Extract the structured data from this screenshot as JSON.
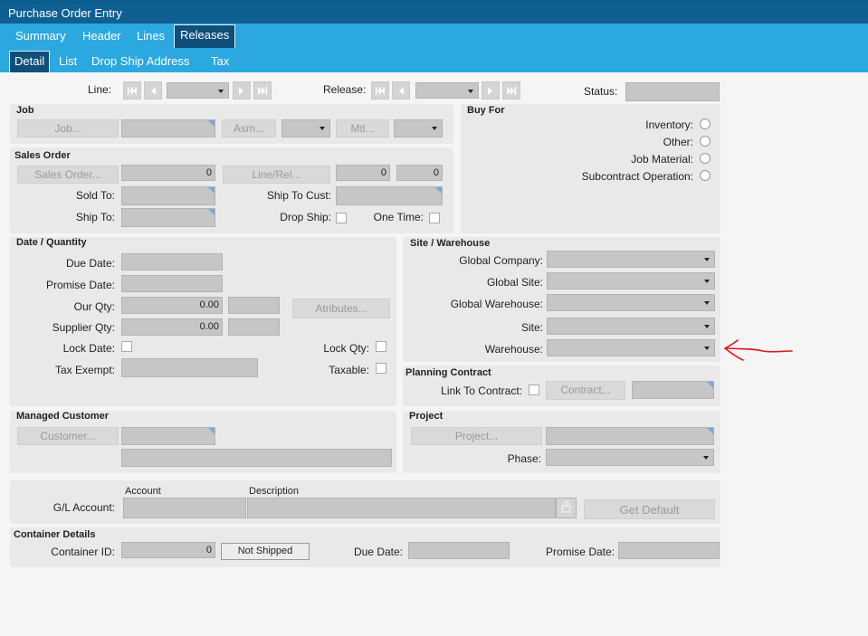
{
  "window": {
    "title": "Purchase Order Entry"
  },
  "tabs_main": [
    {
      "label": "Summary",
      "active": false
    },
    {
      "label": "Header",
      "active": false
    },
    {
      "label": "Lines",
      "active": false
    },
    {
      "label": "Releases",
      "active": true
    }
  ],
  "tabs_sub": [
    {
      "label": "Detail",
      "active": true
    },
    {
      "label": "List",
      "active": false
    },
    {
      "label": "Drop Ship Address",
      "active": false
    },
    {
      "label": "Tax",
      "active": false
    }
  ],
  "nav": {
    "line_label": "Line:",
    "release_label": "Release:",
    "status_label": "Status:"
  },
  "job": {
    "title": "Job",
    "job_button": "Job...",
    "asm_button": "Asm...",
    "mtl_button": "Mtl..."
  },
  "buy_for": {
    "title": "Buy For",
    "options": [
      "Inventory:",
      "Other:",
      "Job Material:",
      "Subcontract Operation:"
    ]
  },
  "sales_order": {
    "title": "Sales Order",
    "sales_order_button": "Sales Order...",
    "sales_order_value": "0",
    "line_rel_button": "Line/Rel...",
    "line_value": "0",
    "rel_value": "0",
    "sold_to_label": "Sold To:",
    "ship_to_cust_label": "Ship To Cust:",
    "ship_to_label": "Ship To:",
    "drop_ship_label": "Drop Ship:",
    "one_time_label": "One Time:"
  },
  "date_qty": {
    "title": "Date / Quantity",
    "due_date_label": "Due Date:",
    "promise_date_label": "Promise Date:",
    "our_qty_label": "Our Qty:",
    "our_qty_value": "0.00",
    "supplier_qty_label": "Supplier Qty:",
    "supplier_qty_value": "0.00",
    "attributes_button": "Atributes...",
    "lock_date_label": "Lock Date:",
    "lock_qty_label": "Lock Qty:",
    "tax_exempt_label": "Tax Exempt:",
    "taxable_label": "Taxable:"
  },
  "site_warehouse": {
    "title": "Site / Warehouse",
    "global_company_label": "Global Company:",
    "global_site_label": "Global Site:",
    "global_warehouse_label": "Global Warehouse:",
    "site_label": "Site:",
    "warehouse_label": "Warehouse:"
  },
  "planning_contract": {
    "title": "Planning Contract",
    "link_label": "Link To Contract:",
    "contract_button": "Contract..."
  },
  "managed_customer": {
    "title": "Managed Customer",
    "customer_button": "Customer..."
  },
  "project": {
    "title": "Project",
    "project_button": "Project...",
    "phase_label": "Phase:"
  },
  "gl": {
    "account_header": "Account",
    "description_header": "Description",
    "gl_account_label": "G/L Account:",
    "get_default_button": "Get Default"
  },
  "container": {
    "title": "Container Details",
    "container_id_label": "Container ID:",
    "container_id_value": "0",
    "not_shipped_button": "Not Shipped",
    "due_date_label": "Due Date:",
    "promise_date_label": "Promise Date:"
  },
  "colors": {
    "title_bar": "#0f5f93",
    "tab_bar": "#2aa8df",
    "active_tab": "#0f4f7a",
    "annotation_arrow": "#e0161b"
  },
  "icons": [
    "first-record-icon",
    "previous-record-icon",
    "next-record-icon",
    "last-record-icon",
    "dropdown-arrow-icon",
    "lookup-corner-icon",
    "annotation-arrow-icon"
  ]
}
